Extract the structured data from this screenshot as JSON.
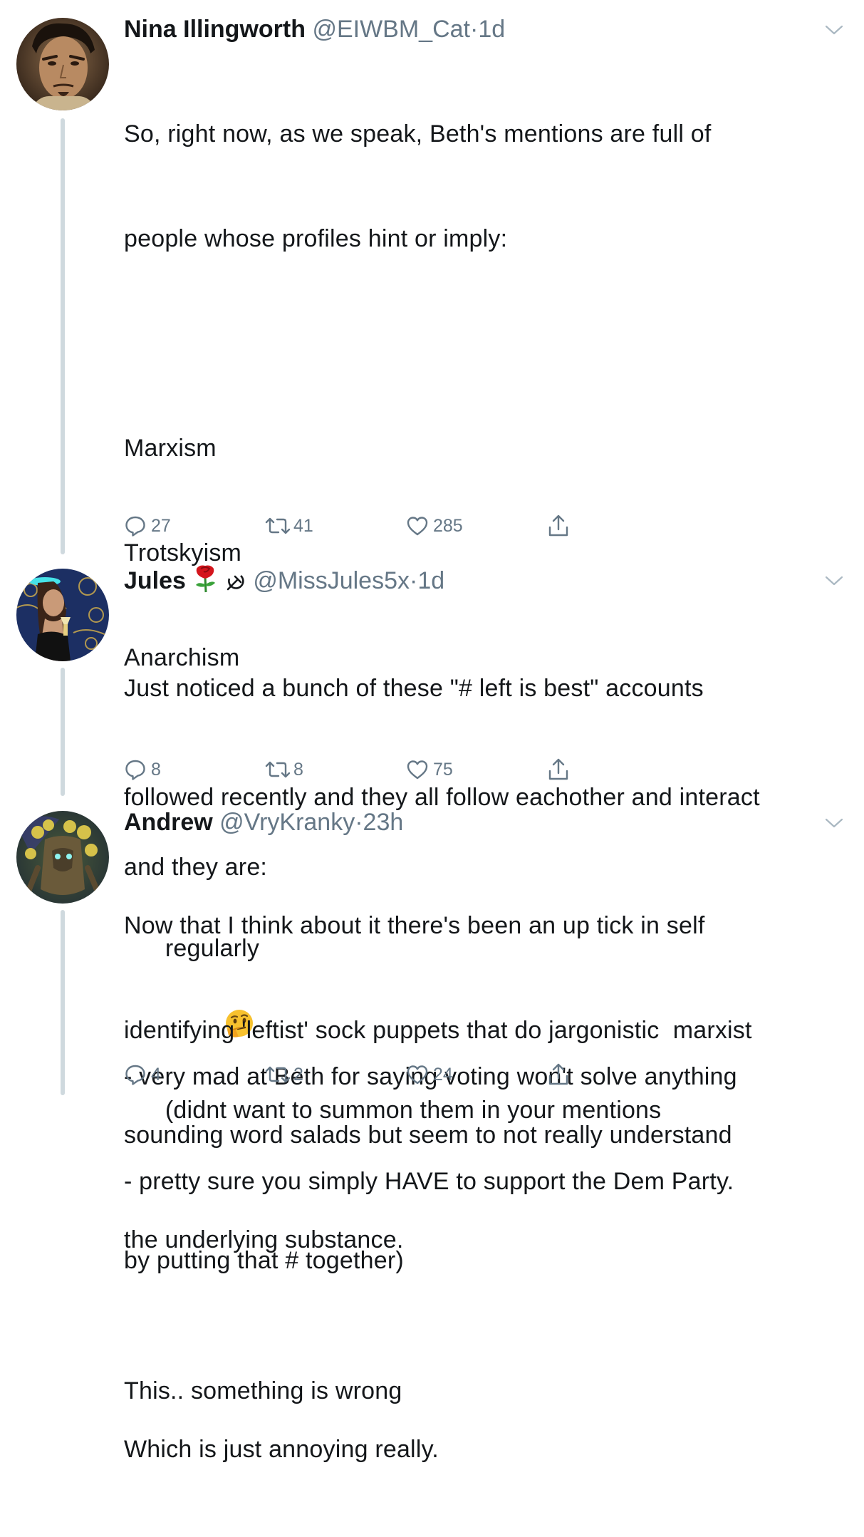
{
  "tweets": [
    {
      "name": "Nina Illingworth",
      "handle": "@EIWBM_Cat",
      "dot": "·",
      "time": "1d",
      "lines": [
        "So, right now, as we speak, Beth's mentions are full of",
        "people whose profiles hint or imply:",
        "",
        "Marxism",
        "Trotskyism",
        "Anarchism",
        "",
        "and they are:",
        "",
        "- very mad at Beth for saying voting won't solve anything",
        "- pretty sure you simply HAVE to support the Dem Party.",
        "",
        "This.. something is wrong"
      ],
      "replies": "27",
      "retweets": "41",
      "likes": "285"
    },
    {
      "name": "Jules",
      "name_emojis": [
        "rose-emoji",
        "hammer-sickle-emoji"
      ],
      "handle": "@MissJules5x",
      "dot": "·",
      "time": "1d",
      "lines": [
        "Just noticed a bunch of these \"# left is best\" accounts",
        "followed recently and they all follow eachother and interact",
        "regularly",
        "(didnt want to summon them in your mentions",
        "by putting that # together)"
      ],
      "inline_emoji": "thinking-face-emoji",
      "replies": "8",
      "retweets": "8",
      "likes": "75"
    },
    {
      "name": "Andrew",
      "handle": "@VryKranky",
      "dot": "·",
      "time": "23h",
      "lines": [
        "Now that I think about it there's been an up tick in self",
        "identifying 'leftist' sock puppets that do jargonistic  marxist",
        "sounding word salads but seem to not really understand",
        "the underlying substance.",
        "",
        "Which is just annoying really."
      ],
      "replies": "4",
      "retweets": "2",
      "likes": "24"
    }
  ],
  "colors": {
    "text": "#14171a",
    "secondary": "#657786",
    "thread_line": "#cfd9de"
  },
  "icons": [
    "reply-icon",
    "retweet-icon",
    "like-icon",
    "share-icon",
    "chevron-down-icon"
  ]
}
